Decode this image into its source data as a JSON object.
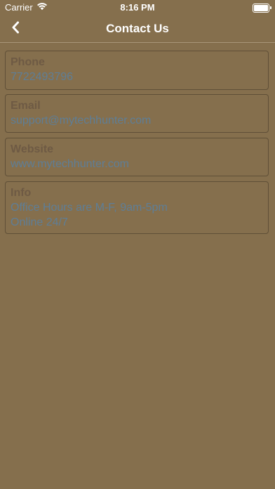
{
  "status_bar": {
    "carrier": "Carrier",
    "time": "8:16 PM",
    "battery_level": 1.0
  },
  "nav": {
    "title": "Contact Us",
    "back_icon": "chevron-left-icon"
  },
  "contacts": {
    "phone": {
      "label": "Phone",
      "value": "7722493796"
    },
    "email": {
      "label": "Email",
      "value": "support@mytechhunter.com"
    },
    "website": {
      "label": "Website",
      "value": "www.mytechhunter.com"
    },
    "info": {
      "label": "Info",
      "line1": "Office Hours are M-F, 9am-5pm",
      "line2": "Online 24/7"
    }
  },
  "colors": {
    "background": "#856f4d",
    "label": "#6e5a44",
    "value": "#5e7e97",
    "border": "#5f4f37"
  }
}
